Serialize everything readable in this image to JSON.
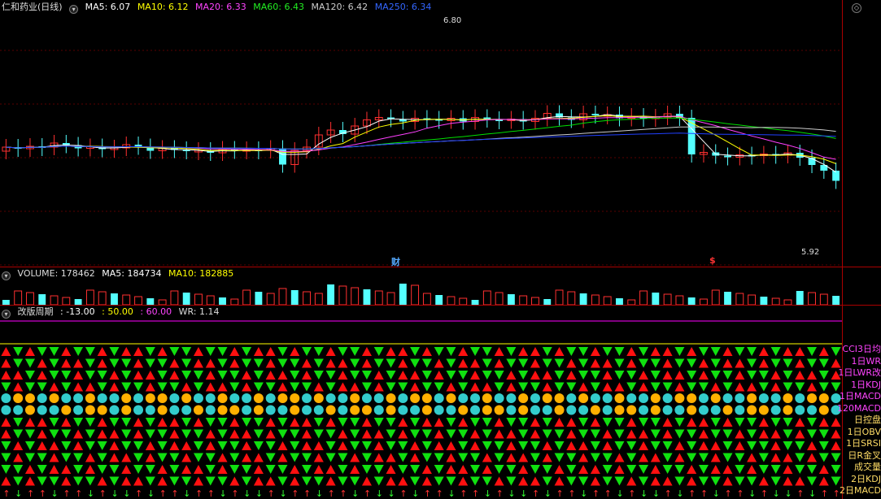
{
  "colors": {
    "up": "#ff3030",
    "down": "#54ffff",
    "ma5": "#ffffff",
    "ma10": "#ffff00",
    "ma20": "#ff40ff",
    "ma60": "#00e000",
    "ma120": "#cccccc",
    "ma250": "#2040ff"
  },
  "header": {
    "title": "仁和药业(日线)",
    "ma5": "MA5: 6.07",
    "ma10": "MA10: 6.12",
    "ma20": "MA20: 6.33",
    "ma60": "MA60: 6.43",
    "ma120": "MA120: 6.42",
    "ma250": "MA250: 6.34"
  },
  "price": {
    "high_label": "6.80",
    "low_label": "5.92",
    "marker_cai": "财",
    "marker_s": "$"
  },
  "volume": {
    "title": "VOLUME: 178462",
    "ma5": "MA5: 184734",
    "ma10": "MA10: 182885"
  },
  "indicator": {
    "title": "改版周期",
    "v1": ": -13.00",
    "v2": ": 50.00",
    "v3": ": 60.00",
    "v4": "WR: 1.14"
  },
  "signal_labels": [
    "CCI3日均",
    "1日WR",
    "1日LWR改",
    "1日KDJ",
    "1日MACD",
    "120MACD",
    "日控盘",
    "1日OBV",
    "1日SRSI",
    "日R金叉",
    "成交量",
    "2日KDJ",
    "2日MACD"
  ]
}
